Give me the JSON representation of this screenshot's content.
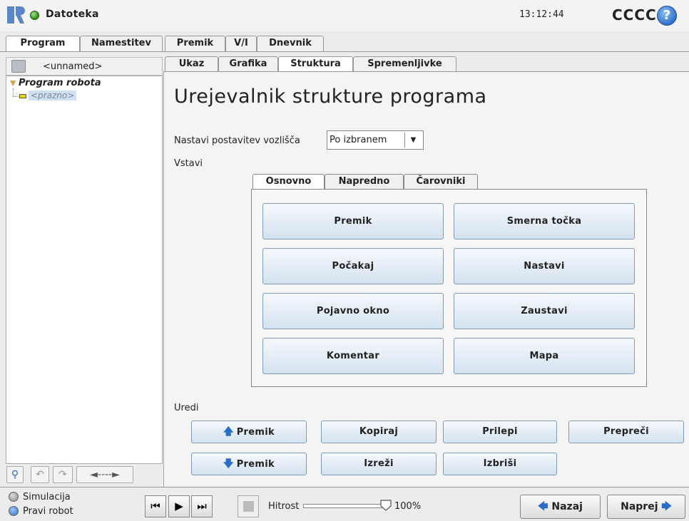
{
  "titlebar": {
    "file_menu": "Datoteka",
    "clock": "13:12:44",
    "robot_name": "CCCC",
    "help": "?"
  },
  "top_tabs": [
    "Program",
    "Namestitev",
    "Premik",
    "V/I",
    "Dnevnik"
  ],
  "left_panel": {
    "program_name": "<unnamed>",
    "tree_root": "Program robota",
    "tree_empty": "<prazno>",
    "toolbar_dash": "◄----►"
  },
  "sub_tabs": [
    "Ukaz",
    "Grafika",
    "Struktura",
    "Spremenljivke"
  ],
  "editor": {
    "title": "Urejevalnik strukture programa",
    "position_label": "Nastavi postavitev vozlišča",
    "position_value": "Po izbranem",
    "insert_label": "Vstavi",
    "insert_tabs": [
      "Osnovno",
      "Napredno",
      "Čarovniki"
    ],
    "insert_buttons": [
      "Premik",
      "Smerna točka",
      "Počakaj",
      "Nastavi",
      "Pojavno okno",
      "Zaustavi",
      "Komentar",
      "Mapa"
    ],
    "edit_label": "Uredi",
    "edit_buttons": {
      "move_up": "Premik",
      "copy": "Kopiraj",
      "paste": "Prilepi",
      "suppress": "Prepreči",
      "move_down": "Premik",
      "cut": "Izreži",
      "delete": "Izbriši"
    }
  },
  "bottom": {
    "simulation": "Simulacija",
    "real_robot": "Pravi robot",
    "speed_label": "Hitrost",
    "speed_value": "100%",
    "speed_fraction": 1.0,
    "back": "Nazaj",
    "next": "Naprej"
  },
  "colors": {
    "accent_blue": "#2a6cc7",
    "status_green": "#2d8a1a",
    "button_gradient_bottom": "#d4e2ef"
  },
  "icons": [
    "ur-logo-icon",
    "status-dot-icon",
    "help-icon",
    "save-icon",
    "search-icon",
    "undo-icon",
    "redo-icon",
    "arrow-up-icon",
    "arrow-down-icon",
    "skip-back-icon",
    "play-icon",
    "step-icon",
    "stop-icon",
    "arrow-left-icon",
    "arrow-right-icon"
  ]
}
